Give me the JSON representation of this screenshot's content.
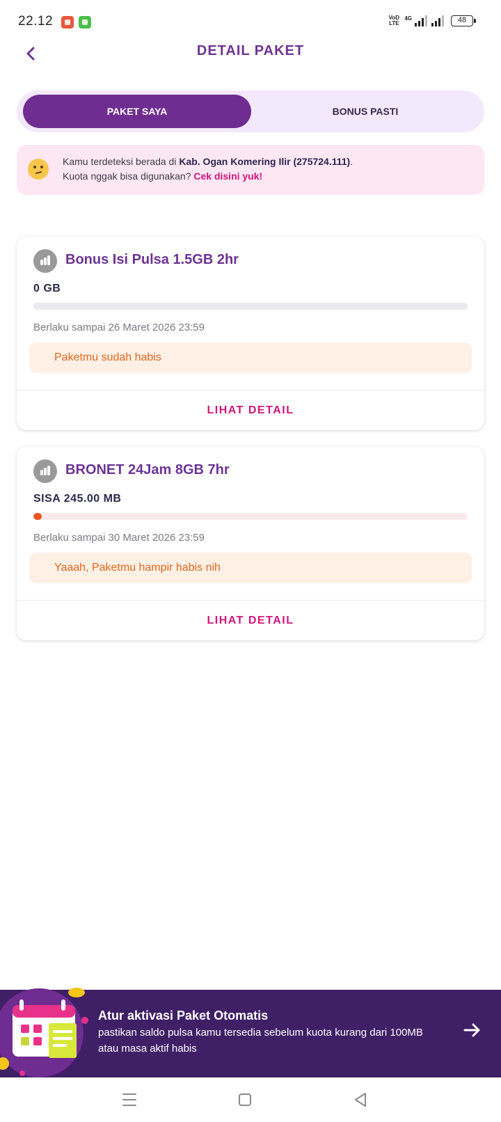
{
  "status_bar": {
    "time": "22.12",
    "network_type": "4G",
    "volte_label": "VoD LTE",
    "battery": "48"
  },
  "header": {
    "title": "DETAIL PAKET"
  },
  "tabs": [
    {
      "label": "PAKET SAYA",
      "active": true
    },
    {
      "label": "BONUS PASTI",
      "active": false
    }
  ],
  "location_notice": {
    "line1_prefix": "Kamu terdeteksi berada di ",
    "location": "Kab. Ogan Komering Ilir (275724.111)",
    "line1_suffix": ".",
    "line2_prefix": "Kuota nggak bisa digunakan? ",
    "link_text": "Cek disini yuk!"
  },
  "packages": [
    {
      "name": "Bonus Isi Pulsa 1.5GB 2hr",
      "remaining": "0 GB",
      "progress_percent": 0,
      "validity": "Berlaku sampai 26 Maret 2026 23:59",
      "alert": "Paketmu sudah habis",
      "action": "LIHAT DETAIL"
    },
    {
      "name": "BRONET 24Jam 8GB 7hr",
      "remaining": "SISA 245.00 MB",
      "progress_percent": 2,
      "validity": "Berlaku sampai 30 Maret 2026 23:59",
      "alert": "Yaaah, Paketmu hampir habis nih",
      "action": "LIHAT DETAIL"
    }
  ],
  "auto_banner": {
    "title": "Atur aktivasi Paket Otomatis",
    "description": "pastikan saldo pulsa kamu tersedia sebelum kuota kurang dari 100MB atau masa aktif habis"
  },
  "colors": {
    "brand_purple": "#6f2c91",
    "accent_pink": "#d0157c",
    "warning_orange": "#e9571e",
    "banner_bg": "#3f1f66"
  }
}
